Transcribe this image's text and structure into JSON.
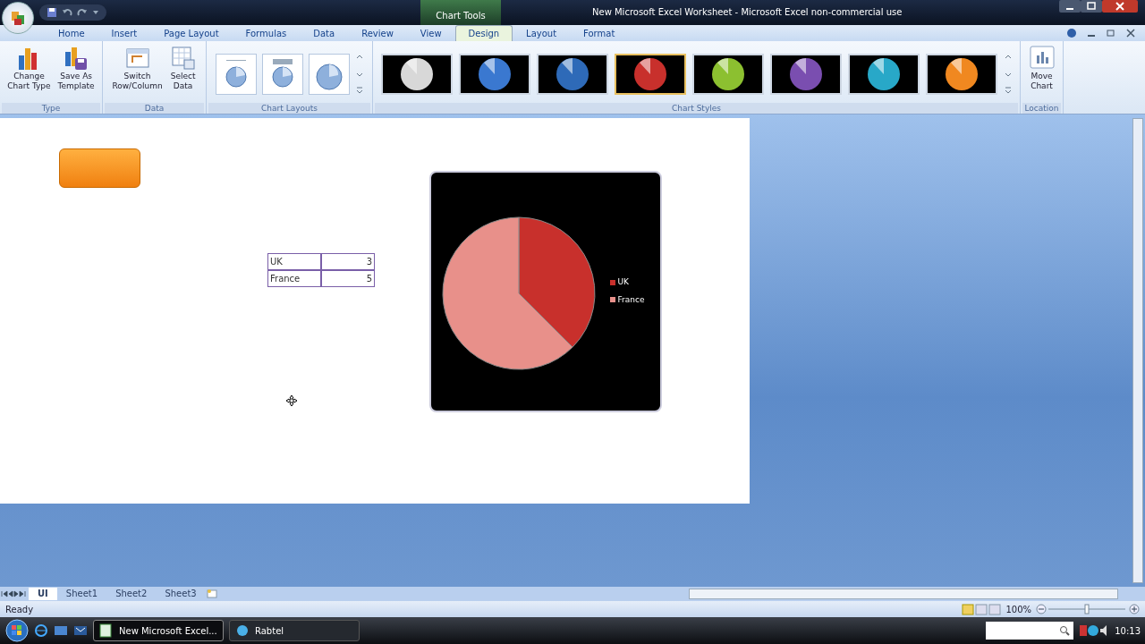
{
  "window": {
    "title": "New Microsoft Excel Worksheet - Microsoft Excel non-commercial use",
    "context_label": "Chart Tools"
  },
  "tabs": [
    {
      "label": "Home",
      "selected": false
    },
    {
      "label": "Insert",
      "selected": false
    },
    {
      "label": "Page Layout",
      "selected": false
    },
    {
      "label": "Formulas",
      "selected": false
    },
    {
      "label": "Data",
      "selected": false
    },
    {
      "label": "Review",
      "selected": false
    },
    {
      "label": "View",
      "selected": false
    },
    {
      "label": "Design",
      "selected": true
    },
    {
      "label": "Layout",
      "selected": false
    },
    {
      "label": "Format",
      "selected": false
    }
  ],
  "ribbon_groups": [
    {
      "label": "Type",
      "kind": "commands",
      "commands": [
        {
          "lines": [
            "Change",
            "Chart Type"
          ]
        },
        {
          "lines": [
            "Save As",
            "Template"
          ]
        }
      ]
    },
    {
      "label": "Data",
      "kind": "commands",
      "commands": [
        {
          "lines": [
            "Switch",
            "Row/Column"
          ]
        },
        {
          "lines": [
            "Select",
            "Data"
          ]
        }
      ]
    },
    {
      "label": "Chart Layouts",
      "kind": "layouts"
    },
    {
      "label": "Chart Styles",
      "kind": "styles",
      "styles": [
        {
          "color": "#d8d8d8",
          "selected": false
        },
        {
          "color": "#3a78d0",
          "selected": false
        },
        {
          "color": "#2e6ab8",
          "selected": false
        },
        {
          "color": "#c8302c",
          "selected": true
        },
        {
          "color": "#8cc030",
          "selected": false
        },
        {
          "color": "#7a4eb0",
          "selected": false
        },
        {
          "color": "#28a8c8",
          "selected": false
        },
        {
          "color": "#f08820",
          "selected": false
        }
      ]
    },
    {
      "label": "Location",
      "kind": "commands",
      "commands": [
        {
          "lines": [
            "Move",
            "Chart"
          ]
        }
      ]
    }
  ],
  "sheet": {
    "cells": [
      [
        "UK",
        "3"
      ],
      [
        "France",
        "5"
      ]
    ],
    "chart_data": {
      "type": "pie",
      "categories": [
        "UK",
        "France"
      ],
      "values": [
        37.5,
        62.5
      ],
      "colors": [
        "#c8302c",
        "#e8908a"
      ],
      "legend": "right"
    }
  },
  "sheet_tabs": [
    {
      "label": "UI",
      "selected": true
    },
    {
      "label": "Sheet1",
      "selected": false
    },
    {
      "label": "Sheet2",
      "selected": false
    },
    {
      "label": "Sheet3",
      "selected": false
    }
  ],
  "status_bar": {
    "text": "Ready",
    "zoom": "100%",
    "zoom_slider": {
      "level": 0.5
    }
  },
  "taskbar": {
    "buttons": [
      {
        "label": "New Microsoft Excel...",
        "selected": true
      },
      {
        "label": "Rabtel",
        "selected": false
      }
    ],
    "time": "10:13"
  }
}
